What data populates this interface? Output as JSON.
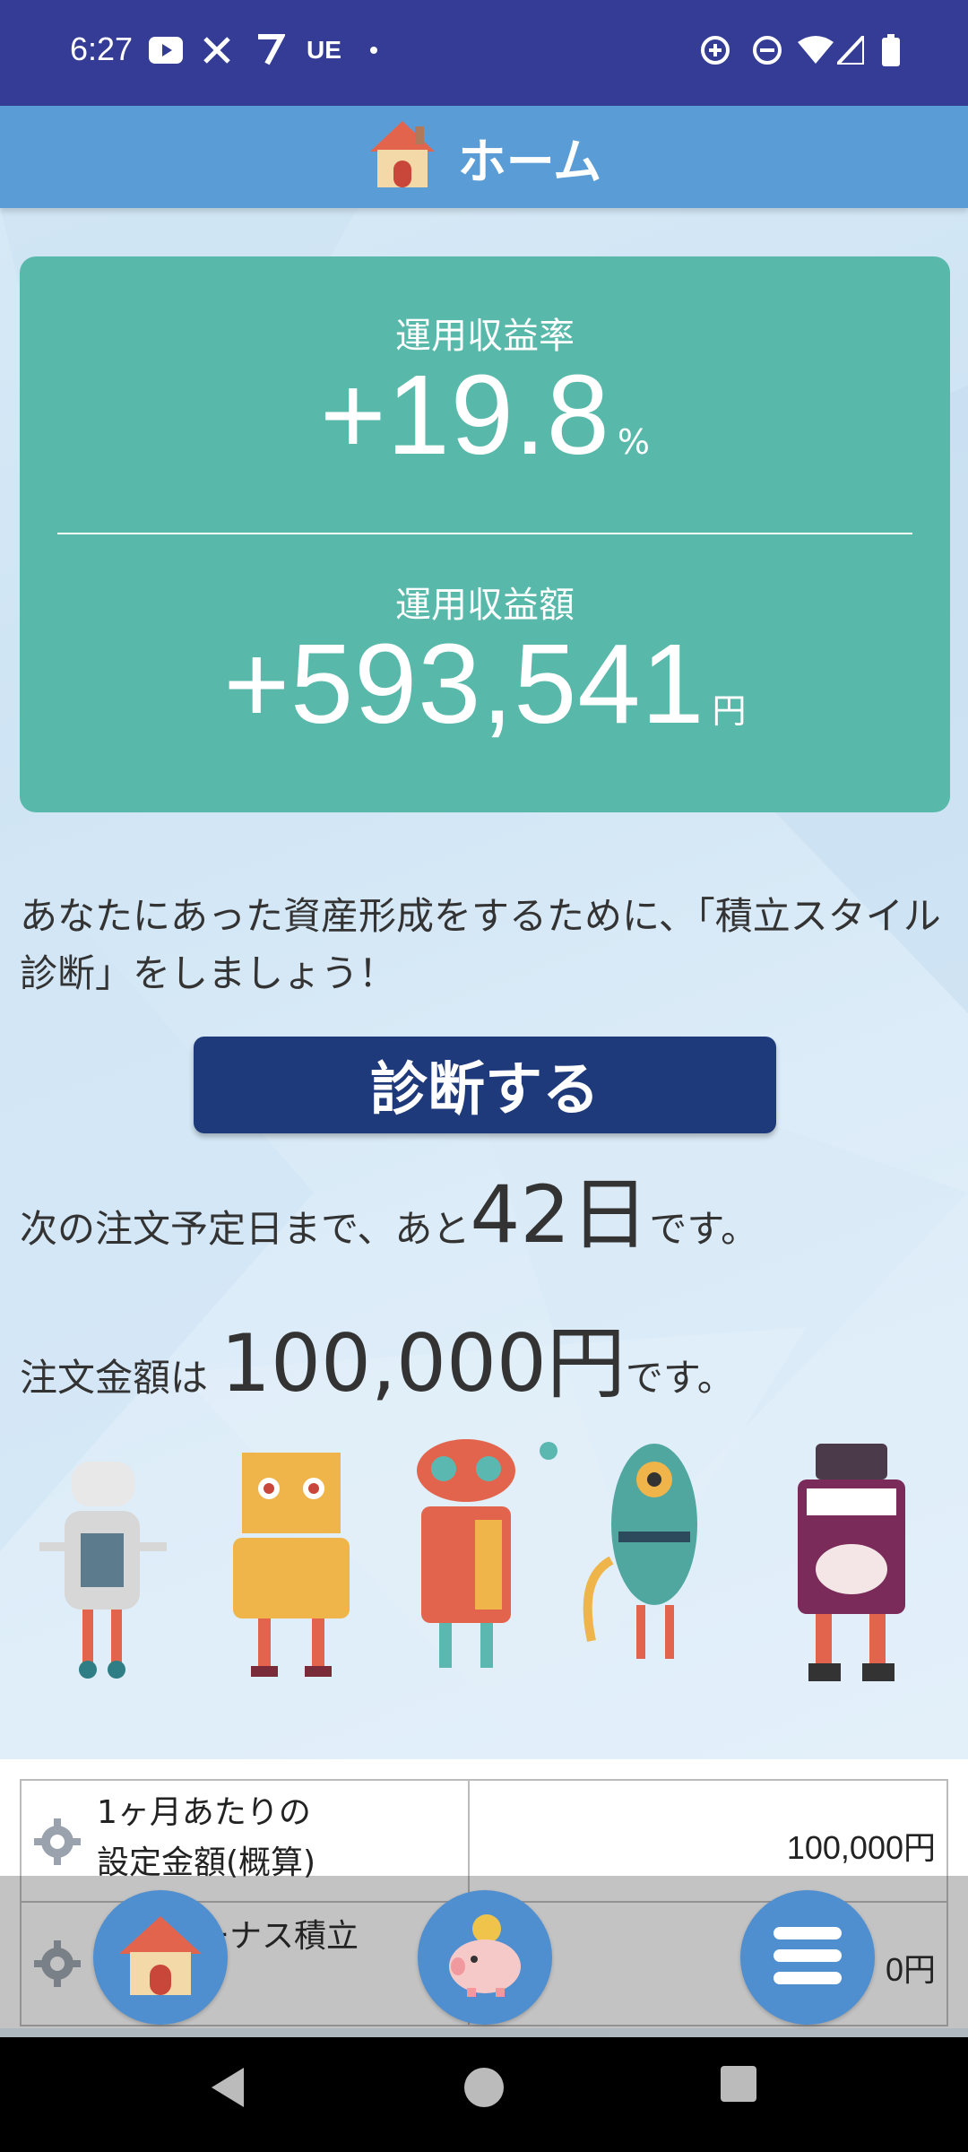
{
  "status_bar": {
    "time": "6:27",
    "icons_left": [
      "youtube-icon",
      "x-icon",
      "7now-icon",
      "ue-icon",
      "dot-icon"
    ],
    "icons_right": [
      "data-saver-icon",
      "dnd-icon",
      "wifi-icon",
      "signal-icon",
      "battery-icon"
    ],
    "ue_label": "UE"
  },
  "header": {
    "title": "ホーム",
    "icon": "house-icon"
  },
  "summary": {
    "rate_label": "運用収益率",
    "rate_value": "+19.8",
    "rate_unit": "%",
    "amount_label": "運用収益額",
    "amount_value": "+593,541",
    "amount_unit": "円"
  },
  "message": "あなたにあった資産形成をするために、「積立スタイル診断」をしましょう！",
  "diagnose_button": "診断する",
  "order_day": {
    "prefix": "次の注文予定日まで、あと",
    "days": "42日",
    "suffix": "です。"
  },
  "order_amount": {
    "prefix": "注文金額は",
    "amount": "100,000円",
    "suffix": "です。"
  },
  "settings_table": [
    {
      "label_line1": "1ヶ月あたりの",
      "label_line2": "設定金額(概算)",
      "value": "100,000円"
    },
    {
      "label_line1": "ボーナス積立",
      "value": "0円"
    }
  ],
  "bottom_buttons": [
    "home-button",
    "piggy-bank-button",
    "menu-button"
  ],
  "colors": {
    "status_bar": "#343c95",
    "header": "#5a9dd6",
    "card": "#58b9aa",
    "button": "#1e3a7b"
  }
}
